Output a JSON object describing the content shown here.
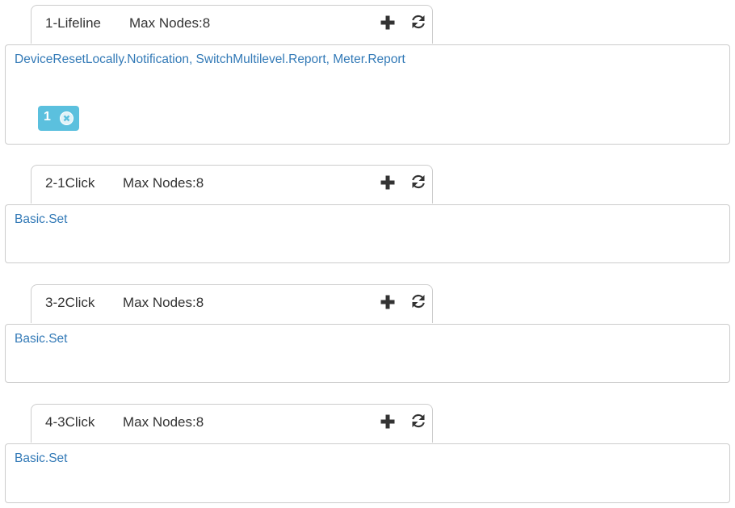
{
  "groups": [
    {
      "name": "1-Lifeline",
      "max_nodes": "Max Nodes:8",
      "command_classes": "DeviceResetLocally.Notification, SwitchMultilevel.Report, Meter.Report",
      "nodes": [
        "1"
      ]
    },
    {
      "name": "2-1Click",
      "max_nodes": "Max Nodes:8",
      "command_classes": "Basic.Set",
      "nodes": []
    },
    {
      "name": "3-2Click",
      "max_nodes": "Max Nodes:8",
      "command_classes": "Basic.Set",
      "nodes": []
    },
    {
      "name": "4-3Click",
      "max_nodes": "Max Nodes:8",
      "command_classes": "Basic.Set",
      "nodes": []
    }
  ],
  "icons": {
    "add": "plus-icon",
    "refresh": "refresh-icon",
    "remove_node": "remove-circle-icon"
  },
  "colors": {
    "link": "#337ab7",
    "badge": "#5bc0de",
    "icon": "#333333"
  }
}
